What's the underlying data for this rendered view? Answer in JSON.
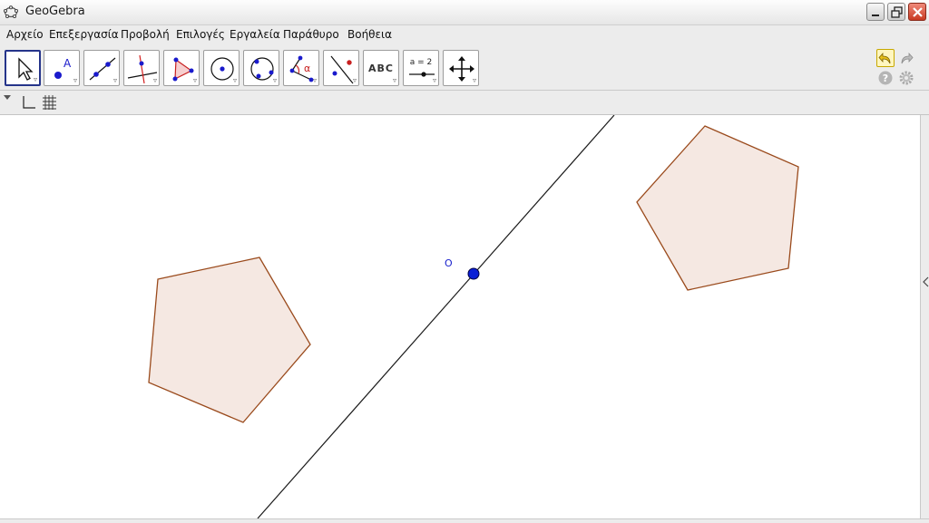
{
  "window": {
    "title": "GeoGebra"
  },
  "menu": {
    "items": [
      {
        "label": "Αρχείο"
      },
      {
        "label": "Επεξεργασία"
      },
      {
        "label": "Προβολή"
      },
      {
        "label": "Επιλογές"
      },
      {
        "label": "Εργαλεία"
      },
      {
        "label": "Παράθυρο"
      },
      {
        "label": "Βοήθεια"
      }
    ]
  },
  "toolbar": {
    "text_tool_label": "ABC",
    "slider_tool_label": "a = 2",
    "point_tool_label": "A",
    "angle_tool_label": "α",
    "selected_tool": "move"
  },
  "canvas": {
    "point_label": "O"
  },
  "colors": {
    "polygon_fill": "#f5e8e2",
    "polygon_stroke": "#9a4a1c",
    "point": "#0a1fd6",
    "line": "#1a1a1a",
    "undo_fill": "#fff6bf"
  }
}
